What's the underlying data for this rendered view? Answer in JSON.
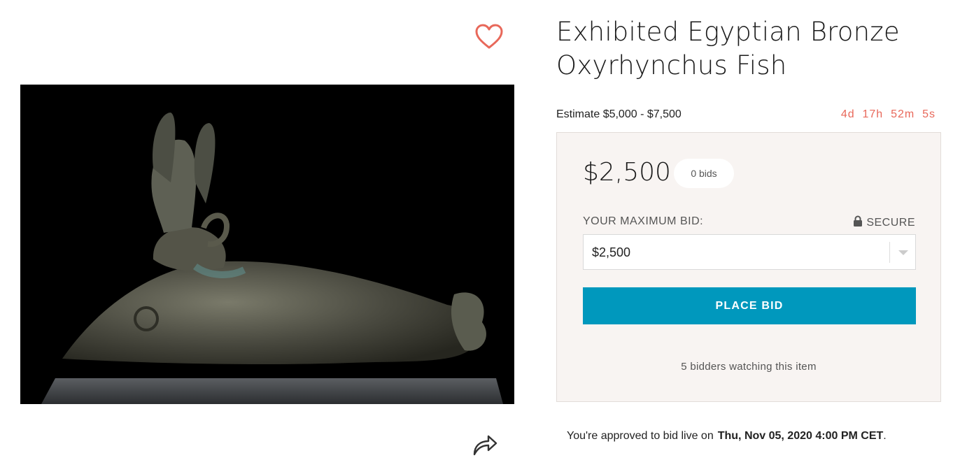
{
  "lot": {
    "title_line1": "Exhibited Egyptian Bronze",
    "title_line2": "Oxyrhynchus Fish",
    "estimate": "Estimate $5,000 - $7,500",
    "countdown": "4d  17h  52m  5s"
  },
  "bidding": {
    "current_bid": "$2,500",
    "bid_count": "0 bids",
    "max_bid_label": "YOUR MAXIMUM BID:",
    "secure_label": "SECURE",
    "max_bid_value": "$2,500",
    "place_bid_label": "PLACE BID",
    "watchers": "5 bidders watching this item"
  },
  "approval": {
    "text": "You're approved to bid live on",
    "date": "Thu, Nov 05, 2020 4:00 PM CET",
    "period": "."
  },
  "icons": {
    "favorite": "heart-icon",
    "share": "share-arrow-icon",
    "secure": "lock-icon",
    "dropdown": "chevron-down-icon"
  },
  "colors": {
    "accent": "#0098bd",
    "countdown": "#e8685a",
    "heart": "#e8685a",
    "panel_bg": "#f8f4f2"
  }
}
